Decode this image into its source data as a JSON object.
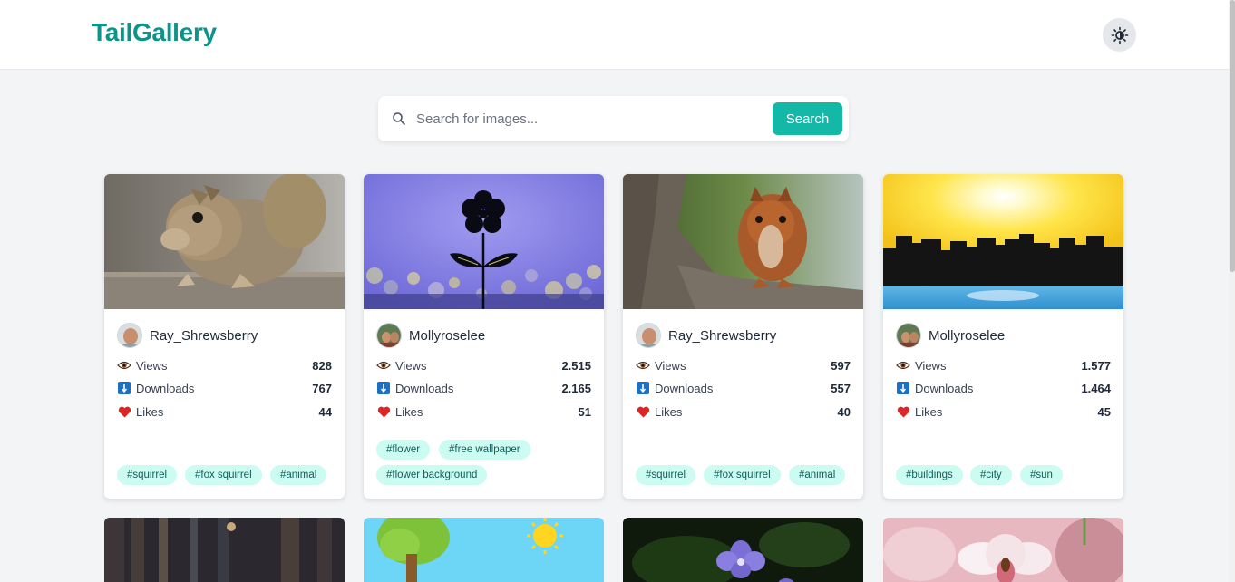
{
  "app": {
    "logo": "TailGallery",
    "theme_toggle_icon": "sun-moon-icon"
  },
  "search": {
    "placeholder": "Search for images...",
    "button_label": "Search"
  },
  "stat_labels": {
    "views": "Views",
    "downloads": "Downloads",
    "likes": "Likes"
  },
  "cards": [
    {
      "image": "squirrel-on-fence-photo",
      "author": "Ray_Shrewsberry",
      "views": "828",
      "downloads": "767",
      "likes": "44",
      "tags": [
        "#squirrel",
        "#fox squirrel",
        "#animal"
      ]
    },
    {
      "image": "flower-silhouette-wallpaper",
      "author": "Mollyroselee",
      "views": "2.515",
      "downloads": "2.165",
      "likes": "51",
      "tags": [
        "#flower",
        "#free wallpaper",
        "#flower background"
      ]
    },
    {
      "image": "squirrel-on-tree-photo",
      "author": "Ray_Shrewsberry",
      "views": "597",
      "downloads": "557",
      "likes": "40",
      "tags": [
        "#squirrel",
        "#fox squirrel",
        "#animal"
      ]
    },
    {
      "image": "city-skyline-sunset",
      "author": "Mollyroselee",
      "views": "1.577",
      "downloads": "1.464",
      "likes": "45",
      "tags": [
        "#buildings",
        "#city",
        "#sun"
      ]
    }
  ],
  "second_row_images": [
    "dark-forest-photo",
    "cartoon-tree-sun",
    "purple-flower-photo",
    "pink-orchid-photo"
  ],
  "colors": {
    "brand": "#0d9488",
    "accent": "#14b8a6",
    "tag_bg": "#ccfbf1",
    "tag_text": "#115e59",
    "page_bg": "#f3f4f6"
  }
}
